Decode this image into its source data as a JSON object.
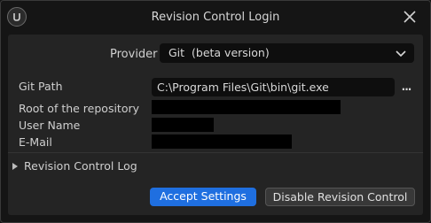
{
  "window": {
    "title": "Revision Control Login",
    "logo_icon": "unreal-engine-logo-icon",
    "close_icon": "close-icon"
  },
  "provider": {
    "label": "Provider",
    "selected": "Git  (beta version)",
    "chevron_icon": "chevron-down-icon"
  },
  "fields": {
    "git_path_label": "Git Path",
    "git_path_value": "C:\\Program Files\\Git\\bin\\git.exe",
    "browse_label": "...",
    "repo_root_label": "Root of the repository",
    "user_name_label": "User Name",
    "email_label": "E-Mail"
  },
  "log": {
    "label": "Revision Control Log",
    "expand_icon": "triangle-right-icon"
  },
  "buttons": {
    "accept": "Accept Settings",
    "disable": "Disable Revision Control"
  },
  "colors": {
    "accent": "#1f6fe0",
    "background": "#151515",
    "panel": "#242424"
  }
}
